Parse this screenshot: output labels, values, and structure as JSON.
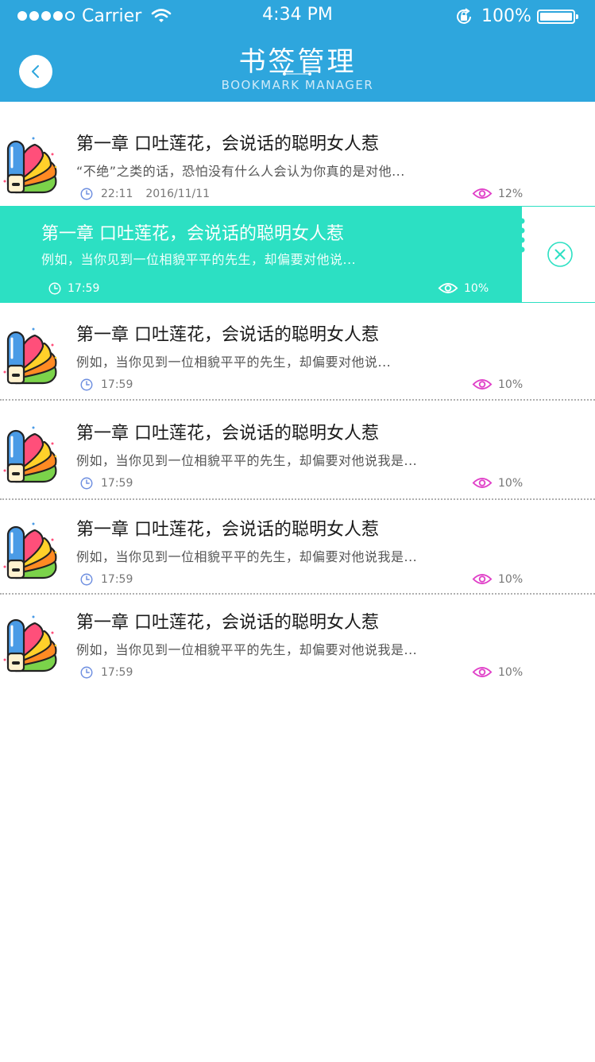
{
  "status_bar": {
    "carrier": "Carrier",
    "time": "4:34 PM",
    "battery": "100%",
    "signal_icon": "signal-dots-icon",
    "wifi_icon": "wifi-icon",
    "lock_icon": "rotation-lock-icon",
    "battery_icon": "battery-icon"
  },
  "header": {
    "title": "书签管理",
    "subtitle": "BOOKMARK MANAGER",
    "back_icon": "chevron-left-icon",
    "bg_color": "#2ea6dd"
  },
  "accent_color": "#2ce0c3",
  "eye_color": "#e040c8",
  "clock_color": "#6e8fe0",
  "bookmarks": [
    {
      "title": "第一章   口吐莲花，会说话的聪明女人惹",
      "excerpt": "“不绝”之类的话，恐怕没有什么人会认为你真的是对他...",
      "time": "22:11",
      "date": "2016/11/11",
      "progress": "12%"
    },
    {
      "title": "第一章   口吐莲花，会说话的聪明女人惹",
      "excerpt": "例如，当你见到一位相貌平平的先生，却偏要对他说...",
      "time": "17:59",
      "progress": "10%",
      "swiped": true,
      "delete_icon": "close-circle-icon"
    },
    {
      "title": "第一章   口吐莲花，会说话的聪明女人惹",
      "excerpt": "例如，当你见到一位相貌平平的先生，却偏要对他说...",
      "time": "17:59",
      "progress": "10%"
    },
    {
      "title": "第一章   口吐莲花，会说话的聪明女人惹",
      "excerpt": "例如，当你见到一位相貌平平的先生，却偏要对他说我是...",
      "time": "17:59",
      "progress": "10%"
    },
    {
      "title": "第一章   口吐莲花，会说话的聪明女人惹",
      "excerpt": "例如，当你见到一位相貌平平的先生，却偏要对他说我是...",
      "time": "17:59",
      "progress": "10%"
    },
    {
      "title": "第一章   口吐莲花，会说话的聪明女人惹",
      "excerpt": "例如，当你见到一位相貌平平的先生，却偏要对他说我是...",
      "time": "17:59",
      "progress": "10%"
    }
  ]
}
